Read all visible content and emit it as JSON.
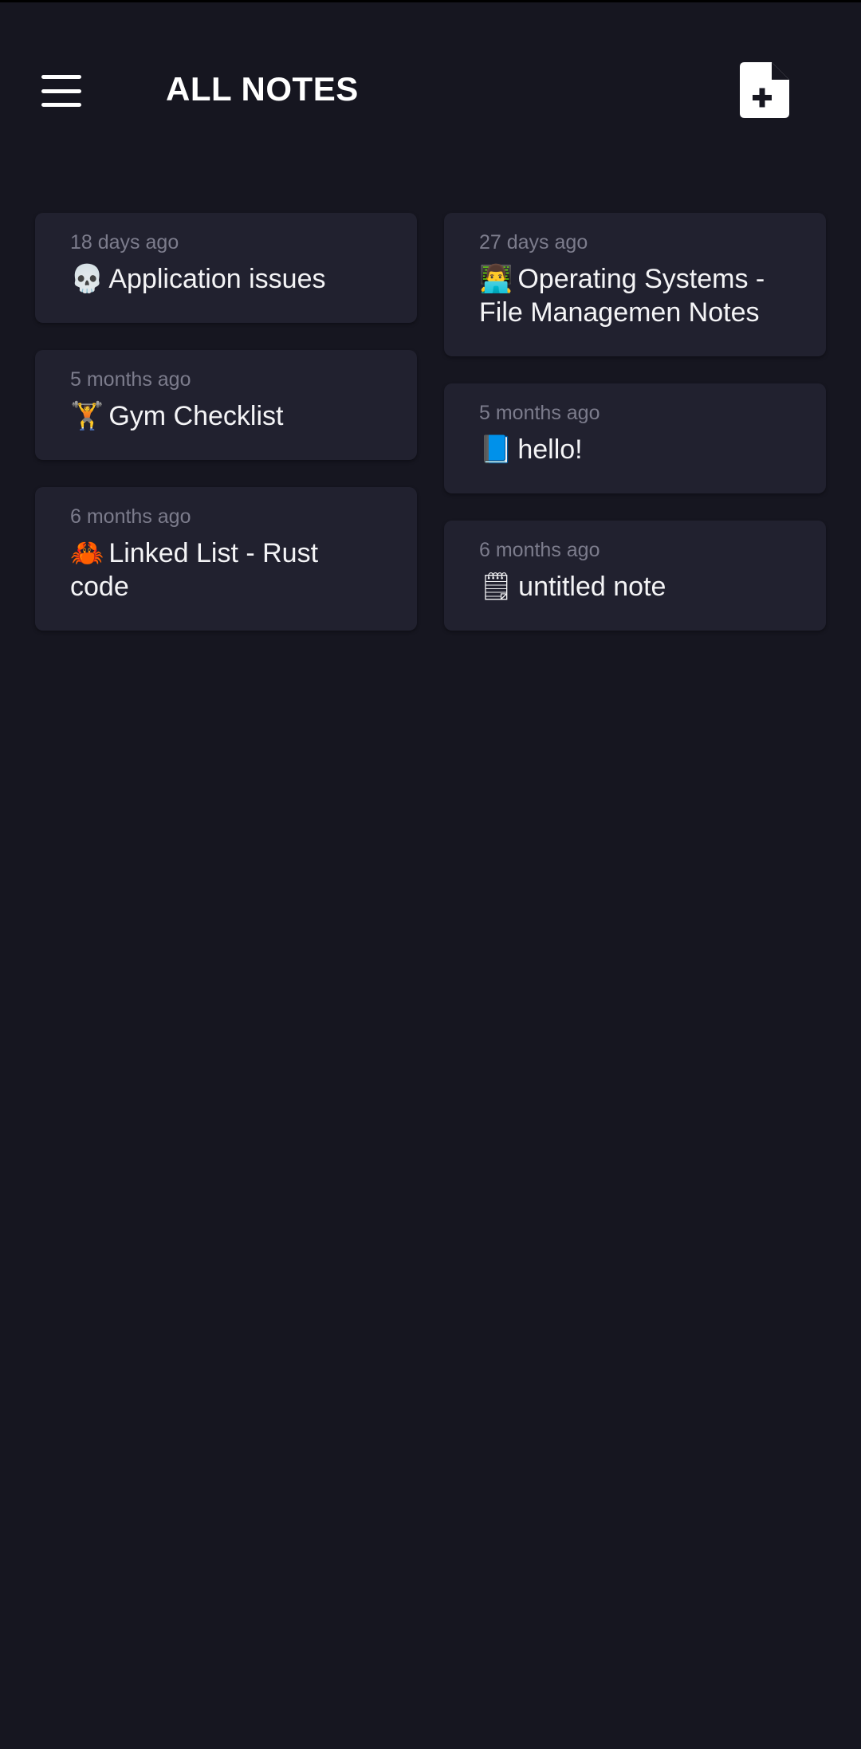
{
  "header": {
    "title": "ALL NOTES"
  },
  "notes": [
    {
      "time": "18 days ago",
      "emoji": "💀",
      "title": "Application issues"
    },
    {
      "time": "27 days ago",
      "emoji": "👨‍💻",
      "title": "Operating Systems - File Managemen Notes"
    },
    {
      "time": "5 months ago",
      "emoji": "🏋",
      "title": "Gym Checklist"
    },
    {
      "time": "5 months ago",
      "emoji": "📘",
      "title": "hello!"
    },
    {
      "time": "6 months ago",
      "emoji": "🦀",
      "title": "Linked List - Rust code"
    },
    {
      "time": "6 months ago",
      "emoji": "🗒",
      "title": "untitled note"
    }
  ],
  "icons": {
    "menu": "hamburger-menu-icon",
    "new_note": "file-plus-icon"
  },
  "colors": {
    "background": "#161620",
    "card": "#21212f",
    "timestamp": "#7c7c8c",
    "text": "#ffffff"
  }
}
